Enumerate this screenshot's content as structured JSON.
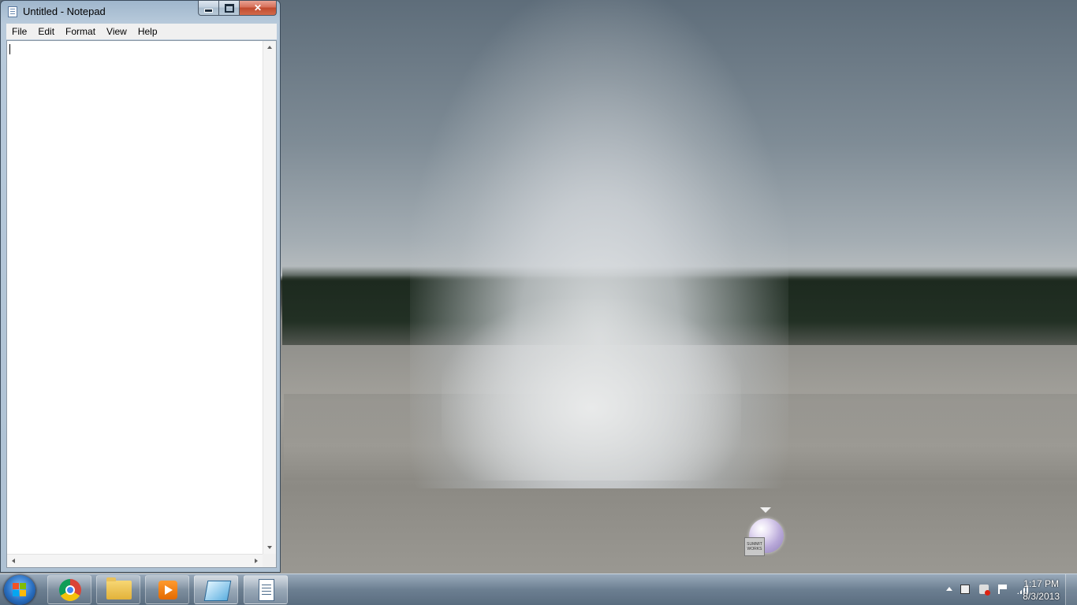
{
  "window": {
    "title": "Untitled - Notepad",
    "close_symbol": "✕",
    "menu": [
      "File",
      "Edit",
      "Format",
      "View",
      "Help"
    ],
    "content": ""
  },
  "gadget": {
    "label": "SUMMIT WORKS"
  },
  "taskbar": {
    "pinned": [
      {
        "name": "chrome-icon"
      },
      {
        "name": "file-explorer-icon"
      },
      {
        "name": "media-player-icon"
      },
      {
        "name": "app-icon"
      },
      {
        "name": "notepad-icon"
      }
    ],
    "clock": {
      "time": "1:17 PM",
      "date": "8/3/2013"
    }
  }
}
